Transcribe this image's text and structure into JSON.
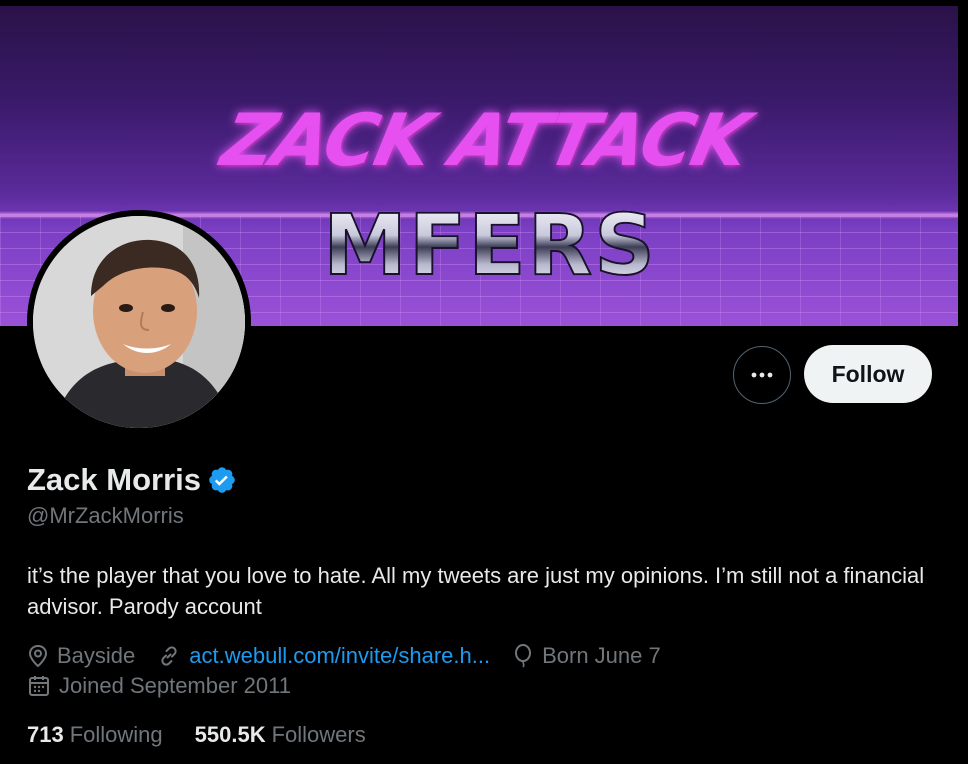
{
  "banner": {
    "line1": "ZACK ATTACK",
    "line2": "MFERS"
  },
  "profile": {
    "display_name": "Zack Morris",
    "handle": "@MrZackMorris",
    "verified": true,
    "bio": "it’s the player that you love to hate. All my tweets are just my opinions. I’m still not a financial advisor. Parody account",
    "location": "Bayside",
    "website": "act.webull.com/invite/share.h...",
    "birthday": "Born June 7",
    "joined": "Joined September 2011"
  },
  "stats": {
    "following_count": "713",
    "following_label": "Following",
    "followers_count": "550.5K",
    "followers_label": "Followers"
  },
  "actions": {
    "more_label": "•••",
    "follow_label": "Follow"
  },
  "colors": {
    "background": "#000000",
    "link": "#1d9bf0",
    "verified": "#1d9bf0",
    "muted": "#71767b",
    "text": "#e7e9ea"
  },
  "icons": {
    "location": "location-pin-icon",
    "website": "link-icon",
    "birthday": "balloon-icon",
    "joined": "calendar-icon",
    "verified": "verified-badge-icon",
    "more": "more-horizontal-icon"
  }
}
